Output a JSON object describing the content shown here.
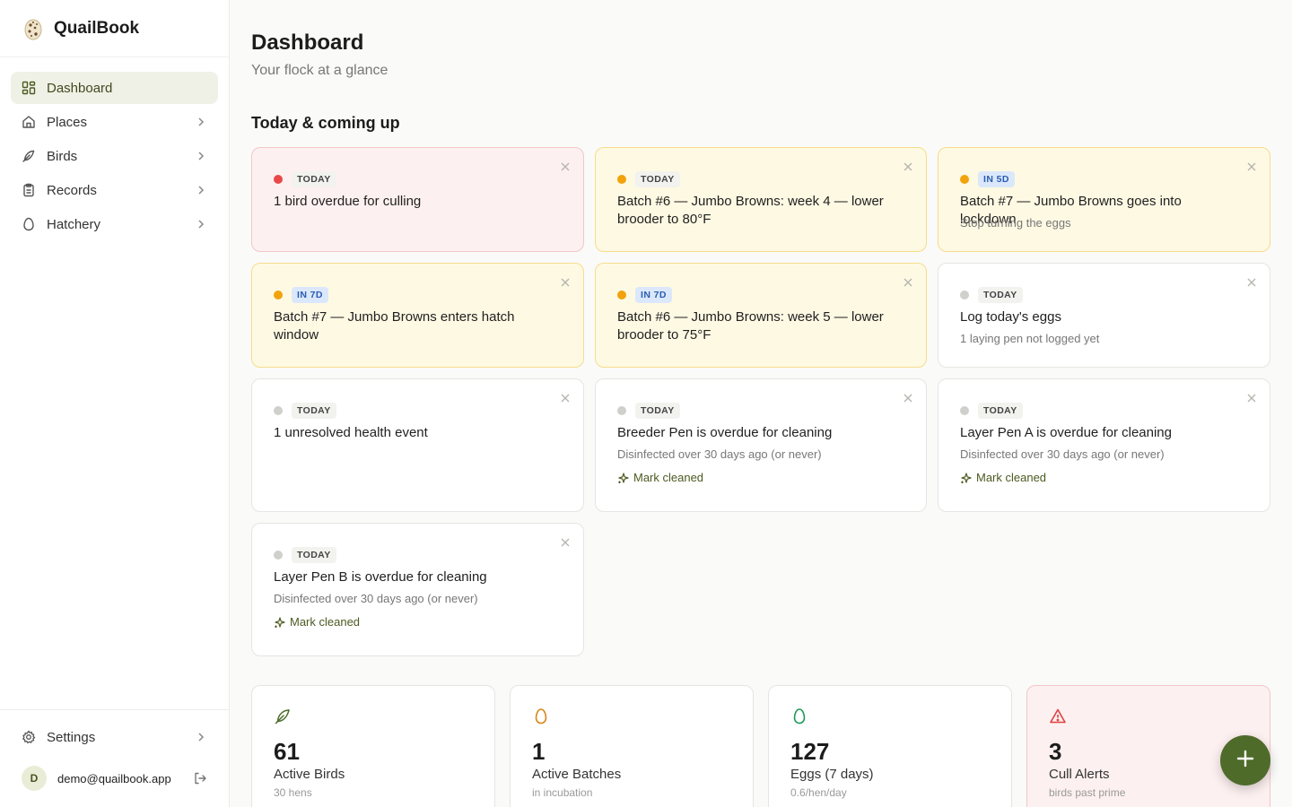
{
  "app": {
    "name": "QuailBook"
  },
  "sidebar": {
    "items": [
      {
        "label": "Dashboard",
        "icon": "dashboard-grid-icon",
        "active": true
      },
      {
        "label": "Places",
        "icon": "home-icon"
      },
      {
        "label": "Birds",
        "icon": "feather-icon"
      },
      {
        "label": "Records",
        "icon": "clipboard-icon"
      },
      {
        "label": "Hatchery",
        "icon": "egg-icon"
      }
    ],
    "settings_label": "Settings",
    "user": {
      "initial": "D",
      "email": "demo@quailbook.app"
    }
  },
  "header": {
    "title": "Dashboard",
    "subtitle": "Your flock at a glance"
  },
  "section": {
    "title": "Today & coming up"
  },
  "cards": [
    {
      "tag": "TODAY",
      "title": "1 bird overdue for culling",
      "sub": "",
      "variant": "red"
    },
    {
      "tag": "TODAY",
      "title": "Batch #6 — Jumbo Browns: week 4 — lower brooder to 80°F",
      "sub": "",
      "variant": "yellow"
    },
    {
      "tag": "IN 5D",
      "title": "Batch #7 — Jumbo Browns goes into lockdown",
      "sub": "Stop turning the eggs",
      "variant": "yellow"
    },
    {
      "tag": "IN 7D",
      "title": "Batch #7 — Jumbo Browns enters hatch window",
      "sub": "",
      "variant": "yellow"
    },
    {
      "tag": "IN 7D",
      "title": "Batch #6 — Jumbo Browns: week 5 — lower brooder to 75°F",
      "sub": "",
      "variant": "yellow"
    },
    {
      "tag": "TODAY",
      "title": "Log today's eggs",
      "sub": "1 laying pen not logged yet",
      "variant": "white"
    },
    {
      "tag": "TODAY",
      "title": "1 unresolved health event",
      "sub": "",
      "variant": "white"
    },
    {
      "tag": "TODAY",
      "title": "Breeder Pen is overdue for cleaning",
      "sub": "Disinfected over 30 days ago (or never)",
      "action": "Mark cleaned",
      "variant": "white"
    },
    {
      "tag": "TODAY",
      "title": "Layer Pen A is overdue for cleaning",
      "sub": "Disinfected over 30 days ago (or never)",
      "action": "Mark cleaned",
      "variant": "white"
    },
    {
      "tag": "TODAY",
      "title": "Layer Pen B is overdue for cleaning",
      "sub": "Disinfected over 30 days ago (or never)",
      "action": "Mark cleaned",
      "variant": "white"
    }
  ],
  "stats": [
    {
      "value": "61",
      "label": "Active Birds",
      "sub": "30 hens",
      "icon": "feather-icon"
    },
    {
      "value": "1",
      "label": "Active Batches",
      "sub": "in incubation",
      "icon": "egg-icon"
    },
    {
      "value": "127",
      "label": "Eggs (7 days)",
      "sub": "0.6/hen/day",
      "icon": "egg-icon"
    },
    {
      "value": "3",
      "label": "Cull Alerts",
      "sub": "birds past prime",
      "icon": "warning-icon"
    }
  ],
  "colors": {
    "accent": "#4f6b2a",
    "danger": "#e84848",
    "warning": "#f2a20c",
    "info": "#2a5db0"
  }
}
